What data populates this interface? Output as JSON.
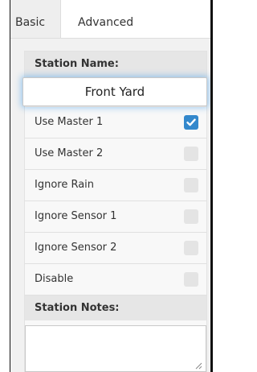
{
  "tabs": [
    {
      "label": "Basic",
      "active": true
    },
    {
      "label": "Advanced",
      "active": false
    }
  ],
  "station_name": {
    "label": "Station Name:",
    "value": "Front Yard"
  },
  "options": [
    {
      "label": "Use Master 1",
      "checked": true
    },
    {
      "label": "Use Master 2",
      "checked": false
    },
    {
      "label": "Ignore Rain",
      "checked": false
    },
    {
      "label": "Ignore Sensor 1",
      "checked": false
    },
    {
      "label": "Ignore Sensor 2",
      "checked": false
    },
    {
      "label": "Disable",
      "checked": false
    }
  ],
  "station_notes": {
    "label": "Station Notes:",
    "value": ""
  },
  "colors": {
    "accent": "#3388cc",
    "focus_glow": "#3898ec"
  }
}
